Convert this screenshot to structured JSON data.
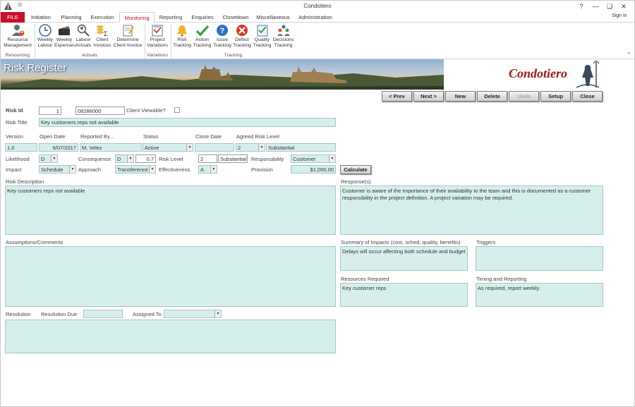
{
  "window": {
    "title": "Condotiero",
    "help": "?",
    "minimize": "—",
    "restore": "❑",
    "close": "✕",
    "signin": "Sign in"
  },
  "tabs": [
    "FILE",
    "Initiation",
    "Planning",
    "Execution",
    "Monitoring",
    "Reporting",
    "Enquiries",
    "Closedown",
    "Miscellaneous",
    "Administration"
  ],
  "ribbon": {
    "buttons": [
      {
        "l1": "Resource",
        "l2": "Management",
        "icon": "user-add-icon"
      },
      {
        "l1": "Weekly",
        "l2": "Labour",
        "icon": "clock-icon"
      },
      {
        "l1": "Weekly",
        "l2": "Expenses",
        "icon": "wallet-icon"
      },
      {
        "l1": "Labour",
        "l2": "Actuals",
        "icon": "search-user-icon"
      },
      {
        "l1": "Client",
        "l2": "Invoices",
        "icon": "invoice-icon"
      },
      {
        "l1": "Determine",
        "l2": "Client Invoice",
        "icon": "invoice-edit-icon"
      },
      {
        "l1": "Project",
        "l2": "Variations",
        "icon": "variations-icon"
      },
      {
        "l1": "Risk",
        "l2": "Tracking",
        "icon": "bell-icon"
      },
      {
        "l1": "Action",
        "l2": "Tracking",
        "icon": "checkmark-icon"
      },
      {
        "l1": "Issue",
        "l2": "Tracking",
        "icon": "question-icon"
      },
      {
        "l1": "Defect",
        "l2": "Tracking",
        "icon": "cancel-icon"
      },
      {
        "l1": "Quality",
        "l2": "Tracking",
        "icon": "checklist-icon"
      },
      {
        "l1": "Decisions",
        "l2": "Tracking",
        "icon": "group-icon"
      }
    ],
    "groups": [
      "Resourcing",
      "Actuals",
      "Variations",
      "Tracking"
    ]
  },
  "banner": {
    "title": "Risk Register",
    "logo": "Condotiero"
  },
  "nav": [
    "< Prev",
    "Next >",
    "New",
    "Delete",
    "Undo",
    "Setup",
    "Close"
  ],
  "form": {
    "risk_id_label": "Risk Id",
    "risk_id": "1",
    "ref": "08286000",
    "client_viewable_label": "Client Viewable?",
    "risk_title_label": "Risk Title",
    "risk_title": "Key customers reps not available",
    "version_label": "Version",
    "version": "1.0",
    "open_date_label": "Open Date",
    "open_date": "6/07/2017",
    "reported_by_label": "Reported By...",
    "reported_by": "M. Velez",
    "status_label": "Status",
    "status": "Active",
    "close_date_label": "Close Date",
    "close_date": "",
    "agreed_label": "Agreed Risk Level",
    "agreed_level": "2",
    "agreed_text": "Substantial",
    "likelihood_label": "Likelihood",
    "likelihood": "D",
    "consequence_label": "Consequence",
    "consequence": "D",
    "consequence_val": "0.7",
    "risk_level_label": "Risk Level",
    "risk_level": "2",
    "risk_level_text": "Substantial",
    "responsibility_label": "Responsibility",
    "responsibility": "Customer",
    "impact_label": "Impact",
    "impact": "Schedule",
    "approach_label": "Approach",
    "approach": "Transference",
    "effectiveness_label": "Effectiveness",
    "effectiveness": "A",
    "provision_label": "Provision",
    "provision": "$1,000.00",
    "calculate": "Calculate",
    "risk_desc_label": "Risk Description",
    "risk_desc": "Key customers reps not available",
    "responses_label": "Response(s)",
    "responses": "Customer is aware of the importance of their availability to the team and this is documented as a customer responsibility in the project definition. A project variation may be required.",
    "assumptions_label": "Assumptions/Comments",
    "assumptions": "",
    "summary_label": "Summary of Impacts (cost, sched, quality, benefits)",
    "summary": "Delays will occur affecting both schedule and budget",
    "triggers_label": "Triggers",
    "triggers": "",
    "resources_label": "Resources Required",
    "resources": "Key customer reps",
    "timing_label": "Timing and Reporting",
    "timing": "As required, report weekly.",
    "resolution_label": "Resolution",
    "resolution_due_label": "Resolution Due",
    "resolution_due": "",
    "assigned_label": "Assigned To",
    "assigned": "",
    "resolution": ""
  },
  "colors": {
    "file_tab": "#c8102e",
    "field_bg": "#d6efed",
    "logo": "#a01818"
  }
}
